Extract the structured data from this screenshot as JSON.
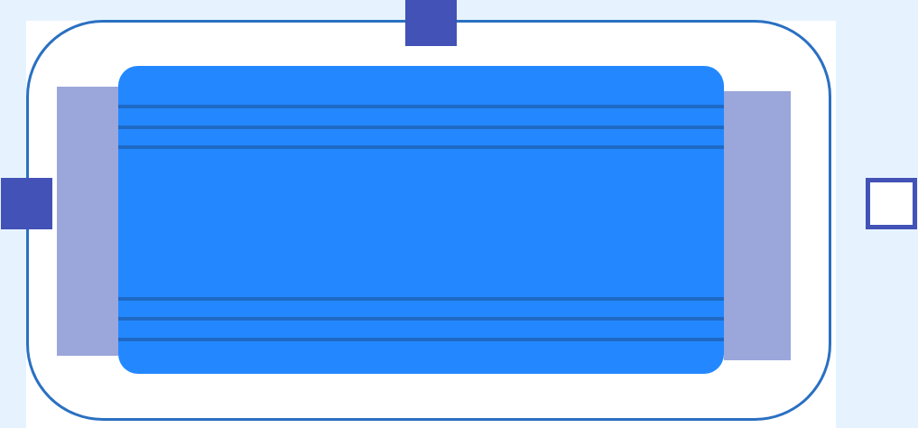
{
  "colors": {
    "page_background": "#e6f3ff",
    "panel_background": "#ffffff",
    "outline": "#2a70c2",
    "side_panels": "#9ba6da",
    "screen": "#2388ff",
    "screen_lines": "#1f69c4",
    "handles": "#4252b7",
    "right_handle_fill": "#ffffff"
  }
}
